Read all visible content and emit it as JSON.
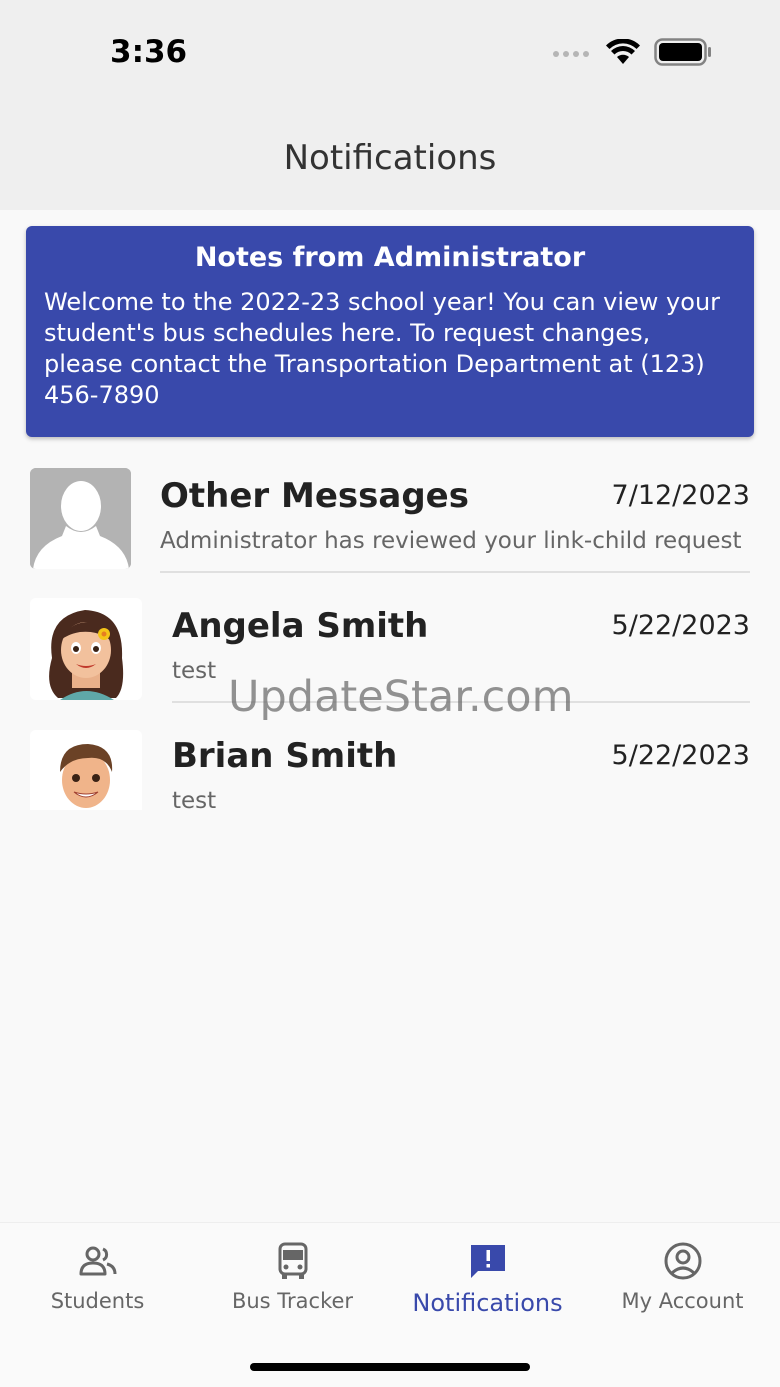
{
  "status_bar": {
    "time": "3:36"
  },
  "header": {
    "title": "Notifications"
  },
  "admin_notes": {
    "title": "Notes from Administrator",
    "body": "Welcome to the 2022-23 school year! You can view your student's bus schedules here. To request changes, please contact the Transportation Department at (123) 456-7890"
  },
  "messages": [
    {
      "name": "Other Messages",
      "date": "7/12/2023",
      "preview": "Administrator has reviewed your link-child request",
      "avatar": "default-person-avatar"
    },
    {
      "name": "Angela Smith",
      "date": "5/22/2023",
      "preview": "test",
      "avatar": "girl-avatar"
    },
    {
      "name": "Brian Smith",
      "date": "5/22/2023",
      "preview": "test",
      "avatar": "boy-avatar"
    }
  ],
  "watermark": "UpdateStar.com",
  "tabs": [
    {
      "label": "Students",
      "icon": "people-icon"
    },
    {
      "label": "Bus Tracker",
      "icon": "bus-icon"
    },
    {
      "label": "Notifications",
      "icon": "alert-message-icon",
      "active": true
    },
    {
      "label": "My Account",
      "icon": "account-circle-icon"
    }
  ],
  "colors": {
    "accent": "#3949ab",
    "background": "#f9f9f9"
  }
}
